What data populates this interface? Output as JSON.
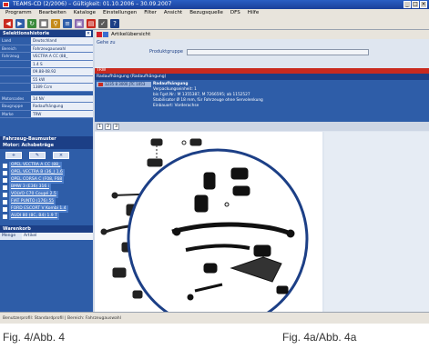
{
  "window": {
    "title": "TEAMS-CD (2/2006) – Gültigkeit: 01.10.2006 – 30.09.2007"
  },
  "menu": [
    "Programm",
    "Bearbeiten",
    "Kataloge",
    "Einstellungen",
    "Filter",
    "Ansicht",
    "Bezugsquelle",
    "DFS",
    "Hilfe"
  ],
  "left_panel": {
    "title": "Selektionshistorie",
    "fields": [
      {
        "key": "Land",
        "value": "Deutschland"
      },
      {
        "key": "Bereich",
        "value": "Fahrzeugauswahl"
      },
      {
        "key": "Fahrzeug",
        "value": "VECTRA A CC (88_"
      },
      {
        "key": "",
        "value": "1.4 S"
      },
      {
        "key": "",
        "value": "09.88-08.92"
      },
      {
        "key": "",
        "value": "55 kW"
      },
      {
        "key": "",
        "value": "1389 Ccm"
      },
      {
        "key": "Motorcodes",
        "value": "14 NV"
      },
      {
        "key": "Baugruppe",
        "value": "Radaufhängung"
      },
      {
        "key": "Marke",
        "value": "TRW"
      }
    ],
    "vehicles_title": "Fahrzeug-Baumuster\nMotor: Achsbeträge",
    "vehicles": [
      "OPEL VECTRA A CC (88_",
      "OPEL VECTRA B (36_) 1.6",
      "OPEL CORSA C (F08, F68",
      "BMW 3 (E36) 316 i",
      "VOLVO C70 Coupé 2.5",
      "FIAT PUNTO (176) 55",
      "FORD ESCORT V Kombi 1.4",
      "AUDI 80 (8C, B4) 1.9 T"
    ],
    "warenkorb": {
      "title": "Warenkorb",
      "col1": "Menge",
      "col2": "Artikel"
    }
  },
  "right_panel": {
    "title": "Artikelübersicht",
    "path_label": "Gehe zu",
    "product_group_label": "Produktgruppe",
    "red_bar": "TRW",
    "section_title": "Radaufhängung (Radaufhängung)",
    "article_code": "1235 8 3000 JTC 1053",
    "detail_lines": [
      "Radaufhängung",
      "Verpackungseinheit: 1",
      "bis Fgst.Nr.: M 1355387, M 7266595; ab 1152527",
      "Stabilisator Ø 18 mm, für Fahrzeuge ohne Servolenkung",
      "Einbauort: Vorderachse"
    ],
    "pages": [
      "1",
      "2",
      "3"
    ]
  },
  "statusbar": "Benutzerprofil: Standardprofil | Bereich: Fahrzeugauswahl",
  "captions": {
    "left": "Fig. 4/Abb. 4",
    "right": "Fig. 4a/Abb. 4a"
  }
}
